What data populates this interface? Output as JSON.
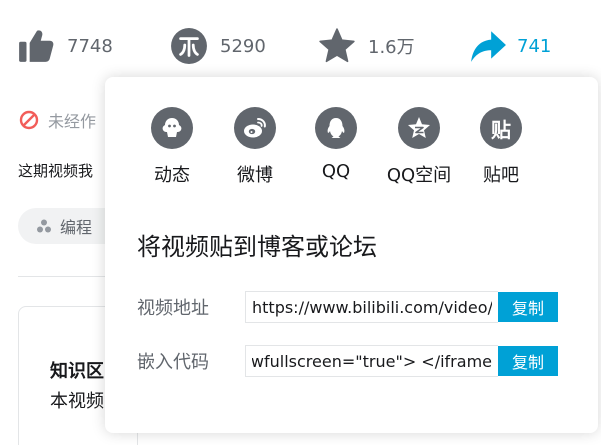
{
  "actions": {
    "like_count": "7748",
    "coin_count": "5290",
    "favorite_count": "1.6万",
    "share_count": "741"
  },
  "video_info": {
    "notice_text": "未经作",
    "description_text": "这期视频我",
    "tag_label": "编程",
    "card_title": "知识区",
    "card_subtitle": "本视频"
  },
  "share_popup": {
    "targets": [
      {
        "label": "动态",
        "icon": "dynamic-icon"
      },
      {
        "label": "微博",
        "icon": "weibo-icon"
      },
      {
        "label": "QQ",
        "icon": "qq-icon"
      },
      {
        "label": "QQ空间",
        "icon": "qzone-icon"
      },
      {
        "label": "贴吧",
        "icon": "tieba-icon"
      }
    ],
    "tieba_glyph": "贴",
    "embed_title": "将视频贴到博客或论坛",
    "url_label": "视频地址",
    "url_value": "https://www.bilibili.com/video/E",
    "code_label": "嵌入代码",
    "code_value": "owfullscreen=\"true\"> </iframe>",
    "copy_label": "复制"
  },
  "colors": {
    "accent": "#00a1d6",
    "icon_gray": "#61666d",
    "text_primary": "#18191c",
    "text_secondary": "#9499a0",
    "warning_red": "#f25d59"
  }
}
